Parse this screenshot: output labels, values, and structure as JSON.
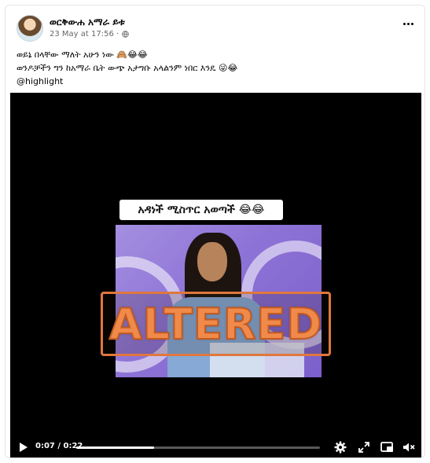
{
  "post": {
    "author": "ወርቅውሐ አማራ ይቱ",
    "timestamp": "23 May at 17:56 ·",
    "text_line_1": "ወይኔ በላቸው ማለት አሁን ነው 🙈😂😂",
    "text_line_2": "ወንዶቻችን ግን ከአማራ ቤት ውጭ አታግቡ አላልንም ነበር እንዴ 😜😂",
    "hashtag": "@highlight"
  },
  "video": {
    "caption": "አዳነች ሚስጥር አወጣች 😂😂",
    "overlay_label": "ALTERED",
    "current_time": "0:07",
    "separator": " / ",
    "duration": "0:22",
    "progress_fraction": 0.32
  },
  "colors": {
    "overlay_accent": "#f08a4b",
    "link": "#050505",
    "meta": "#65676b"
  },
  "icons": {
    "privacy": "globe-icon",
    "more": "more-dots-icon",
    "play": "play-icon",
    "settings": "gear-icon",
    "fullscreen": "expand-icon",
    "pip": "picture-in-picture-icon",
    "volume": "mute-icon"
  }
}
